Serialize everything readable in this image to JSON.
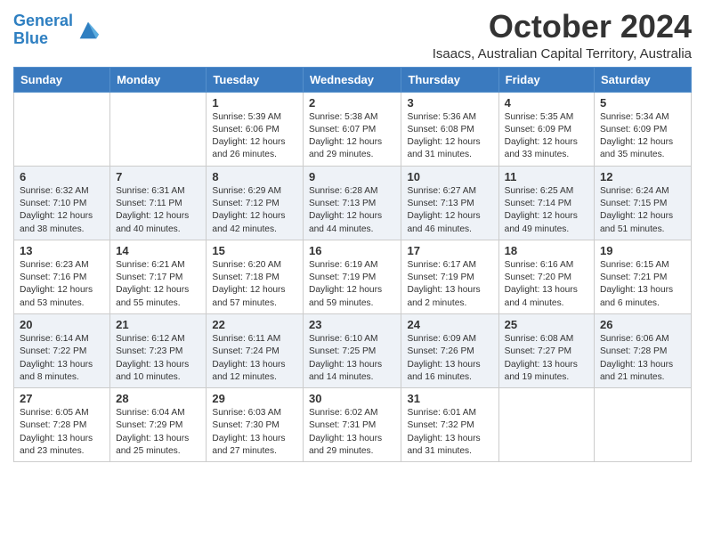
{
  "header": {
    "logo_line1": "General",
    "logo_line2": "Blue",
    "main_title": "October 2024",
    "subtitle": "Isaacs, Australian Capital Territory, Australia"
  },
  "days_of_week": [
    "Sunday",
    "Monday",
    "Tuesday",
    "Wednesday",
    "Thursday",
    "Friday",
    "Saturday"
  ],
  "weeks": [
    [
      {
        "day": "",
        "info": ""
      },
      {
        "day": "",
        "info": ""
      },
      {
        "day": "1",
        "info": "Sunrise: 5:39 AM\nSunset: 6:06 PM\nDaylight: 12 hours and 26 minutes."
      },
      {
        "day": "2",
        "info": "Sunrise: 5:38 AM\nSunset: 6:07 PM\nDaylight: 12 hours and 29 minutes."
      },
      {
        "day": "3",
        "info": "Sunrise: 5:36 AM\nSunset: 6:08 PM\nDaylight: 12 hours and 31 minutes."
      },
      {
        "day": "4",
        "info": "Sunrise: 5:35 AM\nSunset: 6:09 PM\nDaylight: 12 hours and 33 minutes."
      },
      {
        "day": "5",
        "info": "Sunrise: 5:34 AM\nSunset: 6:09 PM\nDaylight: 12 hours and 35 minutes."
      }
    ],
    [
      {
        "day": "6",
        "info": "Sunrise: 6:32 AM\nSunset: 7:10 PM\nDaylight: 12 hours and 38 minutes."
      },
      {
        "day": "7",
        "info": "Sunrise: 6:31 AM\nSunset: 7:11 PM\nDaylight: 12 hours and 40 minutes."
      },
      {
        "day": "8",
        "info": "Sunrise: 6:29 AM\nSunset: 7:12 PM\nDaylight: 12 hours and 42 minutes."
      },
      {
        "day": "9",
        "info": "Sunrise: 6:28 AM\nSunset: 7:13 PM\nDaylight: 12 hours and 44 minutes."
      },
      {
        "day": "10",
        "info": "Sunrise: 6:27 AM\nSunset: 7:13 PM\nDaylight: 12 hours and 46 minutes."
      },
      {
        "day": "11",
        "info": "Sunrise: 6:25 AM\nSunset: 7:14 PM\nDaylight: 12 hours and 49 minutes."
      },
      {
        "day": "12",
        "info": "Sunrise: 6:24 AM\nSunset: 7:15 PM\nDaylight: 12 hours and 51 minutes."
      }
    ],
    [
      {
        "day": "13",
        "info": "Sunrise: 6:23 AM\nSunset: 7:16 PM\nDaylight: 12 hours and 53 minutes."
      },
      {
        "day": "14",
        "info": "Sunrise: 6:21 AM\nSunset: 7:17 PM\nDaylight: 12 hours and 55 minutes."
      },
      {
        "day": "15",
        "info": "Sunrise: 6:20 AM\nSunset: 7:18 PM\nDaylight: 12 hours and 57 minutes."
      },
      {
        "day": "16",
        "info": "Sunrise: 6:19 AM\nSunset: 7:19 PM\nDaylight: 12 hours and 59 minutes."
      },
      {
        "day": "17",
        "info": "Sunrise: 6:17 AM\nSunset: 7:19 PM\nDaylight: 13 hours and 2 minutes."
      },
      {
        "day": "18",
        "info": "Sunrise: 6:16 AM\nSunset: 7:20 PM\nDaylight: 13 hours and 4 minutes."
      },
      {
        "day": "19",
        "info": "Sunrise: 6:15 AM\nSunset: 7:21 PM\nDaylight: 13 hours and 6 minutes."
      }
    ],
    [
      {
        "day": "20",
        "info": "Sunrise: 6:14 AM\nSunset: 7:22 PM\nDaylight: 13 hours and 8 minutes."
      },
      {
        "day": "21",
        "info": "Sunrise: 6:12 AM\nSunset: 7:23 PM\nDaylight: 13 hours and 10 minutes."
      },
      {
        "day": "22",
        "info": "Sunrise: 6:11 AM\nSunset: 7:24 PM\nDaylight: 13 hours and 12 minutes."
      },
      {
        "day": "23",
        "info": "Sunrise: 6:10 AM\nSunset: 7:25 PM\nDaylight: 13 hours and 14 minutes."
      },
      {
        "day": "24",
        "info": "Sunrise: 6:09 AM\nSunset: 7:26 PM\nDaylight: 13 hours and 16 minutes."
      },
      {
        "day": "25",
        "info": "Sunrise: 6:08 AM\nSunset: 7:27 PM\nDaylight: 13 hours and 19 minutes."
      },
      {
        "day": "26",
        "info": "Sunrise: 6:06 AM\nSunset: 7:28 PM\nDaylight: 13 hours and 21 minutes."
      }
    ],
    [
      {
        "day": "27",
        "info": "Sunrise: 6:05 AM\nSunset: 7:28 PM\nDaylight: 13 hours and 23 minutes."
      },
      {
        "day": "28",
        "info": "Sunrise: 6:04 AM\nSunset: 7:29 PM\nDaylight: 13 hours and 25 minutes."
      },
      {
        "day": "29",
        "info": "Sunrise: 6:03 AM\nSunset: 7:30 PM\nDaylight: 13 hours and 27 minutes."
      },
      {
        "day": "30",
        "info": "Sunrise: 6:02 AM\nSunset: 7:31 PM\nDaylight: 13 hours and 29 minutes."
      },
      {
        "day": "31",
        "info": "Sunrise: 6:01 AM\nSunset: 7:32 PM\nDaylight: 13 hours and 31 minutes."
      },
      {
        "day": "",
        "info": ""
      },
      {
        "day": "",
        "info": ""
      }
    ]
  ]
}
